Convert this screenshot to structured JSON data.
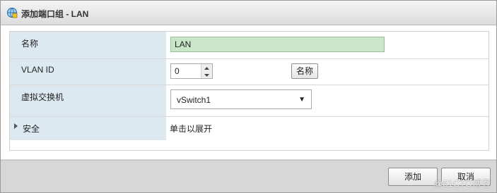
{
  "dialog": {
    "title": "添加端口组 - LAN"
  },
  "form": {
    "name": {
      "label": "名称",
      "value": "LAN"
    },
    "vlan": {
      "label": "VLAN ID",
      "value": "0",
      "side_button": "名称"
    },
    "vswitch": {
      "label": "虚拟交换机",
      "selected": "vSwitch1"
    },
    "security": {
      "label": "安全",
      "expand_hint": "单击以展开"
    }
  },
  "footer": {
    "add_label": "添加",
    "cancel_label": "取消"
  },
  "watermark": "@51CTO博客"
}
